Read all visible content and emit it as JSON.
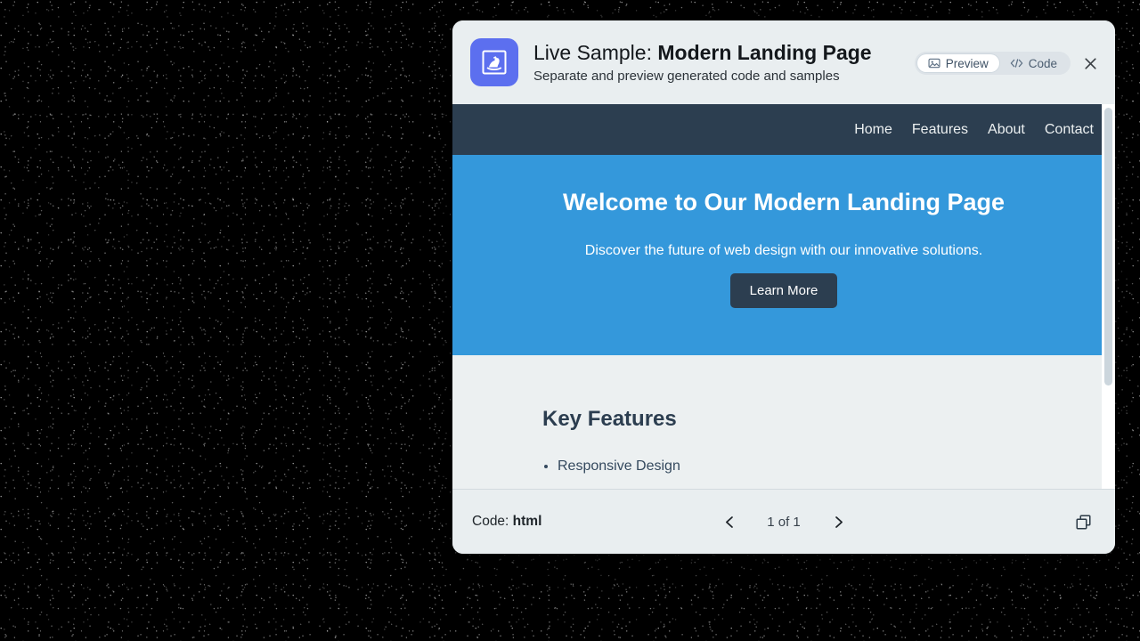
{
  "window": {
    "icon_name": "rocking-horse-icon",
    "icon_bg": "#5c6fef",
    "title_prefix": "Live Sample: ",
    "title_main": "Modern Landing Page",
    "subtitle": "Separate and preview generated code and samples",
    "close_label": "✕"
  },
  "mode_toggle": {
    "preview_label": "Preview",
    "preview_icon": "image-icon",
    "code_label": "Code",
    "code_icon": "angle-brackets-icon",
    "active": "Preview"
  },
  "preview": {
    "nav_links": [
      "Home",
      "Features",
      "About",
      "Contact"
    ],
    "nav_bg": "#2c3e50",
    "hero": {
      "bg": "#3498db",
      "heading": "Welcome to Our Modern Landing Page",
      "subheading": "Discover the future of web design with our innovative solutions.",
      "button_label": "Learn More",
      "button_bg": "#2c3e50"
    },
    "features": {
      "heading": "Key Features",
      "items": [
        "Responsive Design"
      ],
      "bg": "#ecf0f1"
    }
  },
  "footer": {
    "code_prefix": "Code: ",
    "code_language": "html",
    "prev_icon": "chevron-left-icon",
    "next_icon": "chevron-right-icon",
    "page_count": "1 of 1",
    "copy_icon": "copy-icon"
  }
}
